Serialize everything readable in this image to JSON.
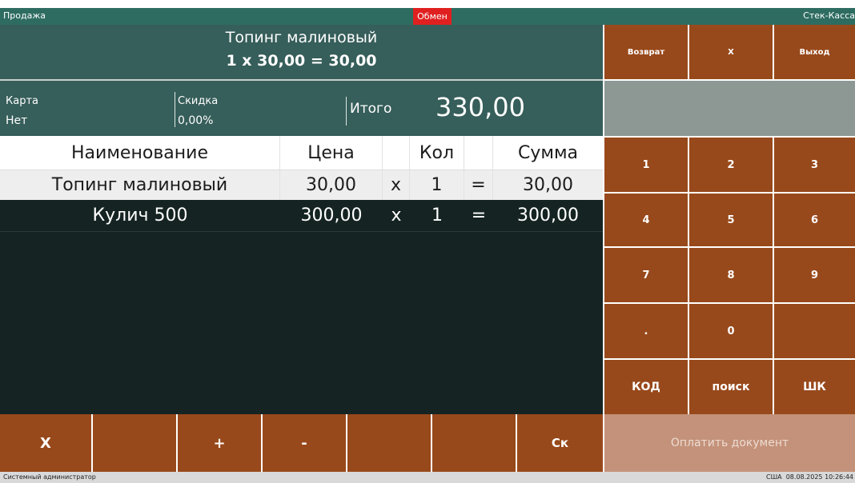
{
  "titlebar": {
    "left": "Продажа",
    "center": "Обмен",
    "right": "Стек-Касса"
  },
  "current_item": {
    "name": "Топинг малиновый",
    "calc": "1 x 30,00 = 30,00"
  },
  "info": {
    "card_label": "Карта",
    "card_value": "Нет",
    "discount_label": "Скидка",
    "discount_value": "0,00%",
    "total_label": "Итого",
    "total_value": "330,00"
  },
  "table": {
    "headers": [
      "Наименование",
      "Цена",
      "",
      "Кол",
      "",
      "Сумма"
    ],
    "rows": [
      [
        "Топинг малиновый",
        "30,00",
        "x",
        "1",
        "=",
        "30,00"
      ],
      [
        "Кулич 500",
        "300,00",
        "x",
        "1",
        "=",
        "300,00"
      ]
    ]
  },
  "top_buttons": [
    "Возврат",
    "X",
    "Выход"
  ],
  "keypad": [
    "1",
    "2",
    "3",
    "4",
    "5",
    "6",
    "7",
    "8",
    "9",
    ".",
    "0",
    "",
    "КОД",
    "поиск",
    "ШК"
  ],
  "bottom_buttons": [
    "X",
    "",
    "+",
    "-",
    "",
    "",
    "Ск"
  ],
  "pay_label": "Оплатить документ",
  "status": {
    "user": "Системный администратор",
    "locale": "США",
    "datetime": "08.08.2025 10:26:44"
  },
  "colors": {
    "accent_brown": "#98491b",
    "panel_teal": "#365e5a",
    "dark_list": "#152422",
    "exchange_red": "#e02020"
  }
}
